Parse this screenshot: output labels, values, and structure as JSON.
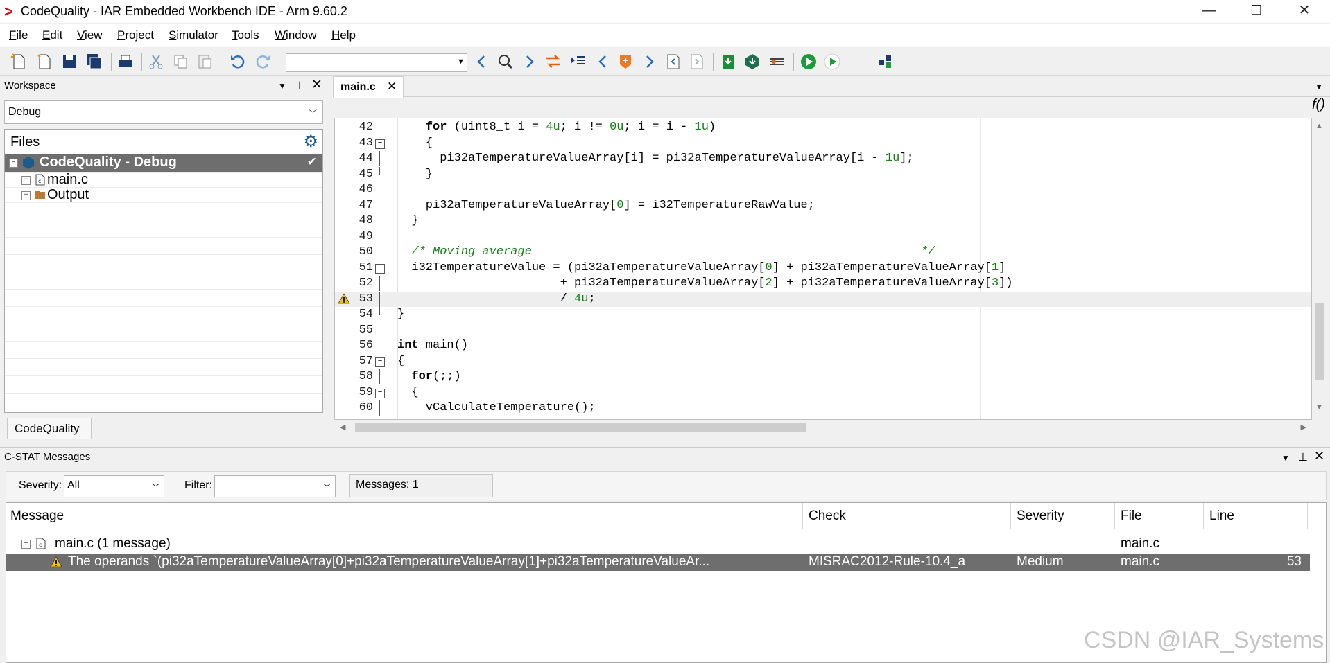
{
  "window": {
    "title": "CodeQuality - IAR Embedded Workbench IDE - Arm 9.60.2",
    "minimize_label": "—",
    "restore_label": "❐",
    "close_label": "✕"
  },
  "menu": [
    {
      "label": "File"
    },
    {
      "label": "Edit"
    },
    {
      "label": "View"
    },
    {
      "label": "Project"
    },
    {
      "label": "Simulator"
    },
    {
      "label": "Tools"
    },
    {
      "label": "Window"
    },
    {
      "label": "Help"
    }
  ],
  "toolbar": {
    "search_value": "",
    "icons": [
      "new-file-icon",
      "new-doc-icon",
      "save-icon",
      "save-all-icon",
      "print-icon",
      "cut-icon",
      "copy-icon",
      "paste-icon",
      "undo-icon",
      "redo-icon",
      "find-prev-icon",
      "find-icon",
      "find-next-icon",
      "replace-icon",
      "goto-icon",
      "nav-back-icon",
      "bookmark-icon",
      "nav-forward-icon",
      "prev-bookmark-icon",
      "next-bookmark-icon",
      "download-icon",
      "download-debug-icon",
      "breakpoint-icon",
      "make-icon",
      "run-icon",
      "debug-icon"
    ]
  },
  "workspace": {
    "title": "Workspace",
    "configuration": "Debug",
    "files_header": "Files",
    "project": "CodeQuality - Debug",
    "items": [
      {
        "label": "main.c",
        "icon": "c-file-icon"
      },
      {
        "label": "Output",
        "icon": "folder-icon"
      }
    ],
    "tab": "CodeQuality"
  },
  "editor": {
    "tab_label": "main.c",
    "function_icon": "f()",
    "lines": [
      {
        "n": "42",
        "text": "    for (uint8_t i = 4u; i != 0u; i = i - 1u)"
      },
      {
        "n": "43",
        "text": "    {"
      },
      {
        "n": "44",
        "text": "      pi32aTemperatureValueArray[i] = pi32aTemperatureValueArray[i - 1u];"
      },
      {
        "n": "45",
        "text": "    }"
      },
      {
        "n": "46",
        "text": ""
      },
      {
        "n": "47",
        "text": "    pi32aTemperatureValueArray[0] = i32TemperatureRawValue;"
      },
      {
        "n": "48",
        "text": "  }"
      },
      {
        "n": "49",
        "text": ""
      },
      {
        "n": "50",
        "text": "  /* Moving average                                                       */"
      },
      {
        "n": "51",
        "text": "  i32TemperatureValue = (pi32aTemperatureValueArray[0] + pi32aTemperatureValueArray[1]"
      },
      {
        "n": "52",
        "text": "                       + pi32aTemperatureValueArray[2] + pi32aTemperatureValueArray[3])"
      },
      {
        "n": "53",
        "text": "                       / 4u;"
      },
      {
        "n": "54",
        "text": "}"
      },
      {
        "n": "55",
        "text": ""
      },
      {
        "n": "56",
        "text": "int main()"
      },
      {
        "n": "57",
        "text": "{"
      },
      {
        "n": "58",
        "text": "  for(;;)"
      },
      {
        "n": "59",
        "text": "  {"
      },
      {
        "n": "60",
        "text": "    vCalculateTemperature();"
      }
    ]
  },
  "messages": {
    "title": "C-STAT Messages",
    "severity_label": "Severity:",
    "severity_value": "All",
    "filter_label": "Filter:",
    "filter_value": "",
    "count": "Messages: 1",
    "columns": {
      "message": "Message",
      "check": "Check",
      "severity": "Severity",
      "file": "File",
      "line": "Line"
    },
    "group": {
      "label": "main.c   (1 message)",
      "file": "main.c"
    },
    "row": {
      "message": "The operands `(pi32aTemperatureValueArray[0]+pi32aTemperatureValueArray[1]+pi32aTemperatureValueAr...",
      "check": "MISRAC2012-Rule-10.4_a",
      "severity": "Medium",
      "file": "main.c",
      "line": "53"
    }
  },
  "watermark": "CSDN @IAR_Systems",
  "colors": {
    "selection": "#6e6e6e",
    "number": "#178017",
    "brand_red": "#d0141b",
    "warning": "#f5c400"
  }
}
